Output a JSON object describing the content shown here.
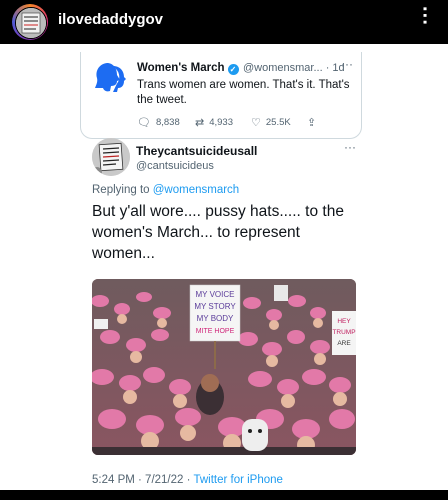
{
  "story": {
    "username": "ilovedaddygov",
    "more_icon": "more-vertical-icon"
  },
  "quoted_tweet": {
    "author_name": "Women's March",
    "handle_time": "@womensmar... · 1d",
    "more": "···",
    "text": "Trans women are women. That's it. That's the tweet.",
    "replies": "8,838",
    "retweets": "4,933",
    "likes": "25.5K",
    "colors": {
      "brand_blue": "#1d6cf2",
      "verified": "#1d9bf0"
    }
  },
  "main_tweet": {
    "author_name": "Theycantsuicideusall",
    "handle": "@cantsuicideus",
    "more": "···",
    "replying_prefix": "Replying to",
    "replying_handle": "@womensmarch",
    "text": "But y'all wore.... pussy hats..... to the women's March... to represent women...",
    "avatar_sign": "I KEEP VOTE FOR CHILDREN",
    "photo": {
      "sign_main": [
        "MY VOICE",
        "MY STORY",
        "MY BODY",
        "MITE HOPE"
      ],
      "sign_right": [
        "HEY",
        "TRUMP",
        "ARE"
      ]
    },
    "time": "5:24 PM · 7/21/22 ·",
    "source": "Twitter for iPhone"
  }
}
